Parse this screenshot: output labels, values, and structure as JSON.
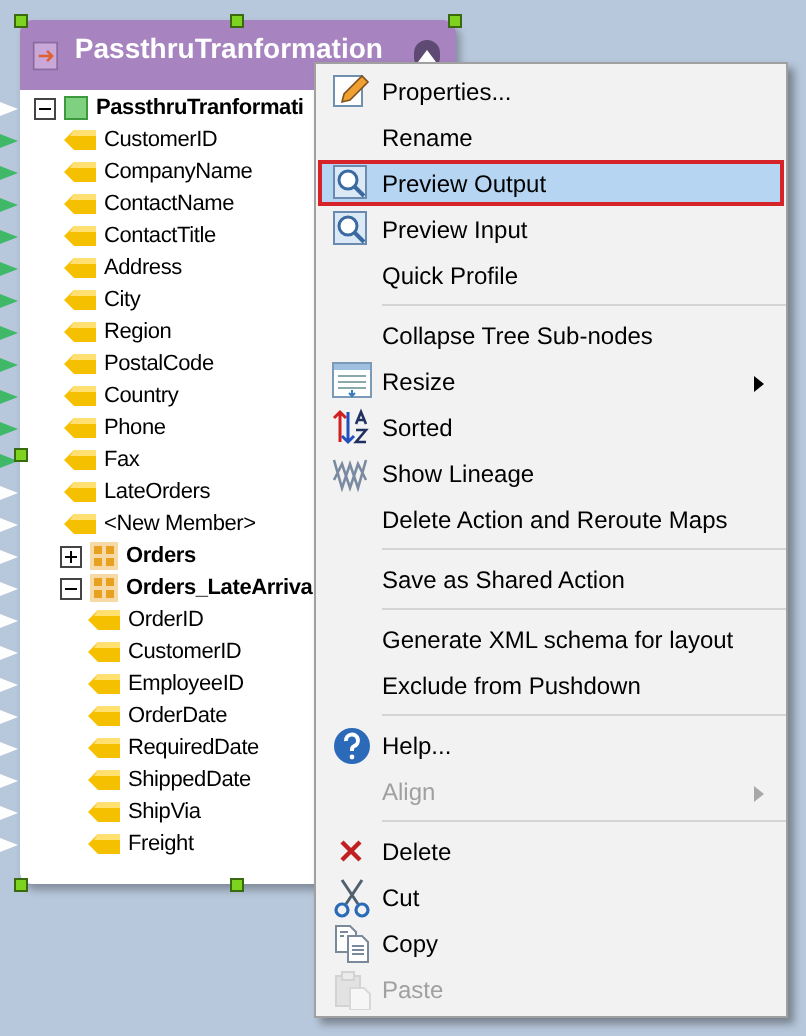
{
  "node": {
    "title": "PassthruTranformation",
    "tree": {
      "kind": "root",
      "label": "PassthruTranformati",
      "expanded": true,
      "children": [
        {
          "kind": "field",
          "label": "CustomerID",
          "mapped": true
        },
        {
          "kind": "field",
          "label": "CompanyName",
          "mapped": true
        },
        {
          "kind": "field",
          "label": "ContactName",
          "mapped": true
        },
        {
          "kind": "field",
          "label": "ContactTitle",
          "mapped": true
        },
        {
          "kind": "field",
          "label": "Address",
          "mapped": true
        },
        {
          "kind": "field",
          "label": "City",
          "mapped": true
        },
        {
          "kind": "field",
          "label": "Region",
          "mapped": true
        },
        {
          "kind": "field",
          "label": "PostalCode",
          "mapped": true
        },
        {
          "kind": "field",
          "label": "Country",
          "mapped": true
        },
        {
          "kind": "field",
          "label": "Phone",
          "mapped": true
        },
        {
          "kind": "field",
          "label": "Fax",
          "mapped": true
        },
        {
          "kind": "field",
          "label": "LateOrders",
          "mapped": false
        },
        {
          "kind": "field",
          "label": "<New Member>",
          "mapped": false
        },
        {
          "kind": "group",
          "label": "Orders",
          "expanded": false
        },
        {
          "kind": "group",
          "label": "Orders_LateArriva",
          "expanded": true,
          "children": [
            {
              "kind": "field",
              "label": "OrderID",
              "mapped": false
            },
            {
              "kind": "field",
              "label": "CustomerID",
              "mapped": false
            },
            {
              "kind": "field",
              "label": "EmployeeID",
              "mapped": false
            },
            {
              "kind": "field",
              "label": "OrderDate",
              "mapped": false
            },
            {
              "kind": "field",
              "label": "RequiredDate",
              "mapped": false
            },
            {
              "kind": "field",
              "label": "ShippedDate",
              "mapped": false
            },
            {
              "kind": "field",
              "label": "ShipVia",
              "mapped": false
            },
            {
              "kind": "field",
              "label": "Freight",
              "mapped": false
            }
          ]
        }
      ]
    }
  },
  "context_menu": {
    "items": [
      {
        "kind": "item",
        "label": "Properties...",
        "selected": false,
        "disabled": false,
        "submenu": false
      },
      {
        "kind": "item",
        "label": "Rename",
        "selected": false,
        "disabled": false,
        "submenu": false
      },
      {
        "kind": "item",
        "label": "Preview Output",
        "selected": true,
        "disabled": false,
        "submenu": false
      },
      {
        "kind": "item",
        "label": "Preview Input",
        "selected": false,
        "disabled": false,
        "submenu": false
      },
      {
        "kind": "item",
        "label": "Quick Profile",
        "selected": false,
        "disabled": false,
        "submenu": false
      },
      {
        "kind": "separator"
      },
      {
        "kind": "item",
        "label": "Collapse Tree Sub-nodes",
        "selected": false,
        "disabled": false,
        "submenu": false
      },
      {
        "kind": "item",
        "label": "Resize",
        "selected": false,
        "disabled": false,
        "submenu": true
      },
      {
        "kind": "item",
        "label": "Sorted",
        "selected": false,
        "disabled": false,
        "submenu": false
      },
      {
        "kind": "item",
        "label": "Show Lineage",
        "selected": false,
        "disabled": false,
        "submenu": false
      },
      {
        "kind": "item",
        "label": "Delete Action and Reroute Maps",
        "selected": false,
        "disabled": false,
        "submenu": false
      },
      {
        "kind": "separator"
      },
      {
        "kind": "item",
        "label": "Save as Shared Action",
        "selected": false,
        "disabled": false,
        "submenu": false
      },
      {
        "kind": "separator"
      },
      {
        "kind": "item",
        "label": "Generate XML schema for layout",
        "selected": false,
        "disabled": false,
        "submenu": false
      },
      {
        "kind": "item",
        "label": "Exclude from Pushdown",
        "selected": false,
        "disabled": false,
        "submenu": false
      },
      {
        "kind": "separator"
      },
      {
        "kind": "item",
        "label": "Help...",
        "selected": false,
        "disabled": false,
        "submenu": false
      },
      {
        "kind": "item",
        "label": "Align",
        "selected": false,
        "disabled": true,
        "submenu": true
      },
      {
        "kind": "separator"
      },
      {
        "kind": "item",
        "label": "Delete",
        "selected": false,
        "disabled": false,
        "submenu": false
      },
      {
        "kind": "item",
        "label": "Cut",
        "selected": false,
        "disabled": false,
        "submenu": false
      },
      {
        "kind": "item",
        "label": "Copy",
        "selected": false,
        "disabled": false,
        "submenu": false
      },
      {
        "kind": "item",
        "label": "Paste",
        "selected": false,
        "disabled": true,
        "submenu": false
      }
    ]
  }
}
